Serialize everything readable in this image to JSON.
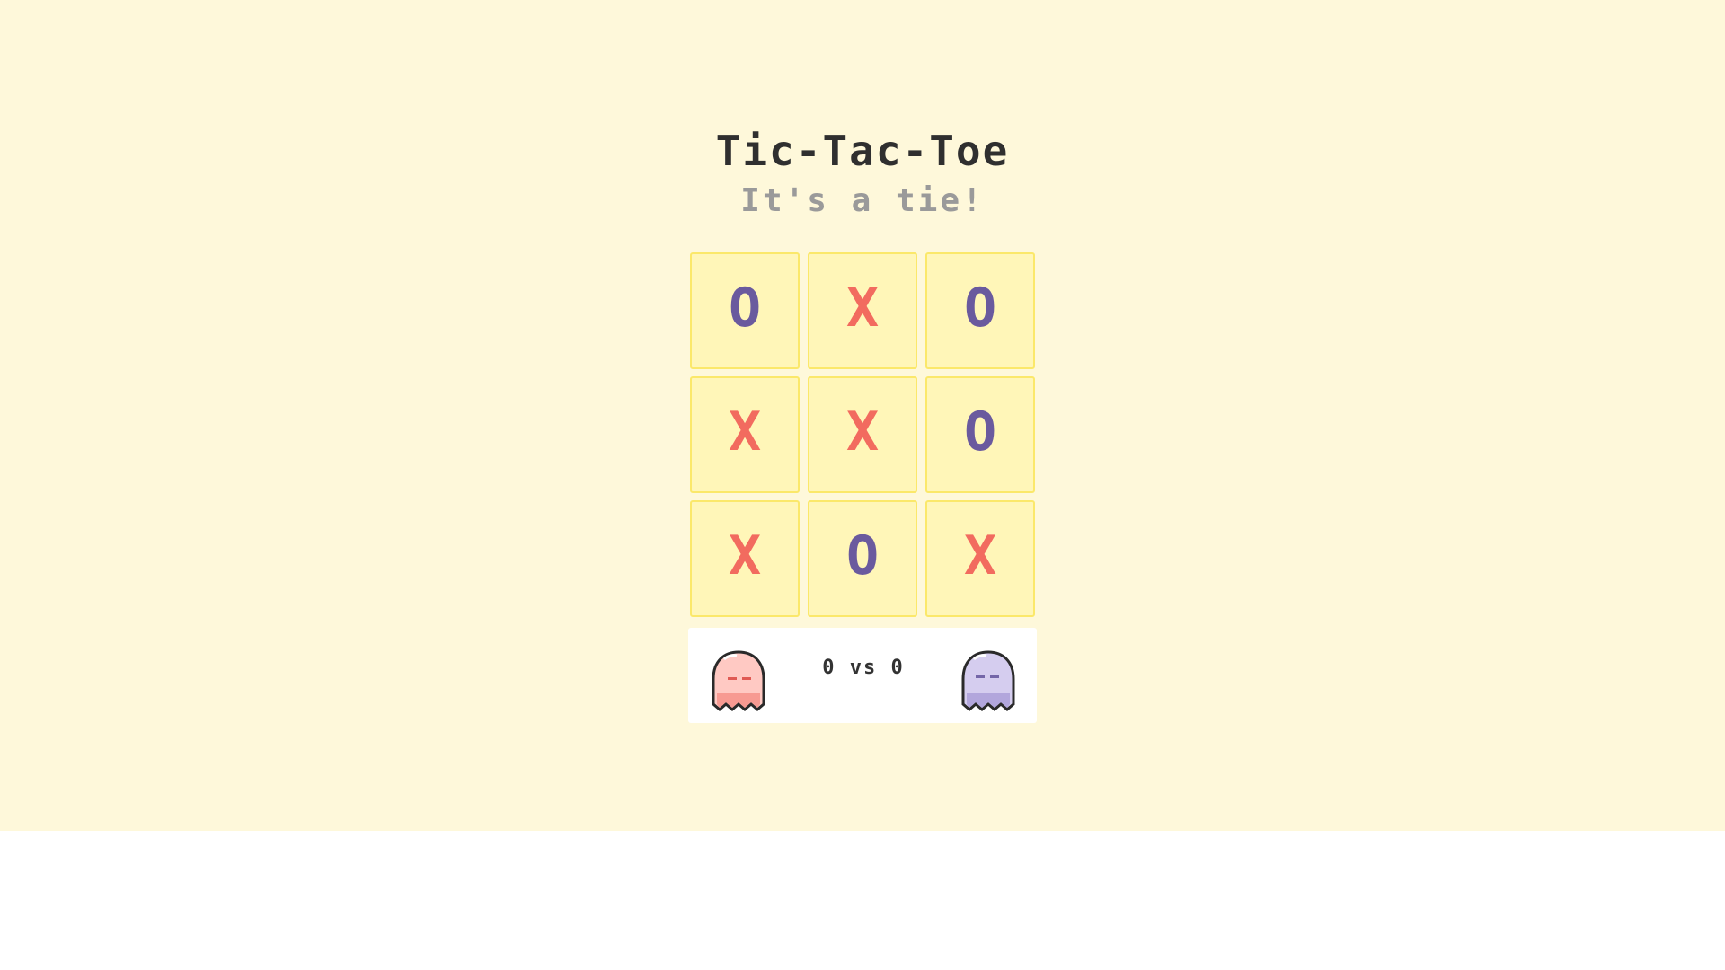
{
  "title": "Tic-Tac-Toe",
  "status": "It's a tie!",
  "board": {
    "cells": [
      "O",
      "X",
      "O",
      "X",
      "X",
      "O",
      "X",
      "O",
      "X"
    ]
  },
  "score": {
    "x_score": "0",
    "separator": "vs",
    "o_score": "0"
  },
  "players": {
    "x_icon": "pink-ghost-icon",
    "o_icon": "purple-ghost-icon"
  },
  "colors": {
    "background": "#fef8da",
    "cell": "#fff6b8",
    "cell_border": "#fbe86a",
    "x_mark": "#f26b5f",
    "o_mark": "#6a5a9e",
    "status": "#9a9a9a"
  }
}
